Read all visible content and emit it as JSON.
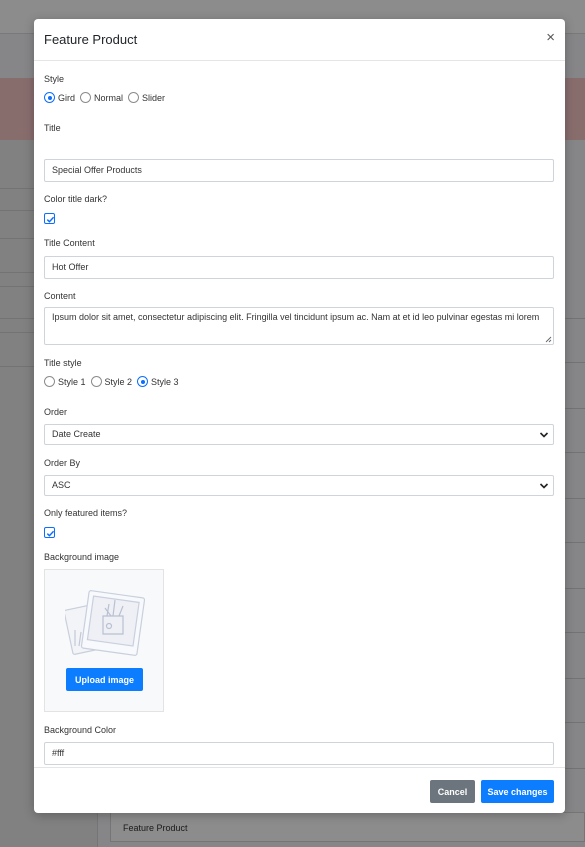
{
  "modal": {
    "title": "Feature Product",
    "close_symbol": "×"
  },
  "form": {
    "style": {
      "label": "Style",
      "options": [
        "Gird",
        "Normal",
        "Slider"
      ],
      "selected": "Gird"
    },
    "title": {
      "label": "Title",
      "value": "Special Offer Products"
    },
    "color_title_dark": {
      "label": "Color title dark?",
      "checked": true
    },
    "title_content": {
      "label": "Title Content",
      "value": "Hot Offer"
    },
    "content": {
      "label": "Content",
      "value": "Ipsum dolor sit amet, consectetur adipiscing elit. Fringilla vel tincidunt ipsum ac. Nam at et id leo pulvinar egestas mi lorem"
    },
    "title_style": {
      "label": "Title style",
      "options": [
        "Style 1",
        "Style 2",
        "Style 3"
      ],
      "selected": "Style 3"
    },
    "order": {
      "label": "Order",
      "value": "Date Create"
    },
    "order_by": {
      "label": "Order By",
      "value": "ASC"
    },
    "only_featured": {
      "label": "Only featured items?",
      "checked": true
    },
    "background_image": {
      "label": "Background image",
      "upload_label": "Upload image"
    },
    "background_color": {
      "label": "Background Color",
      "value": "#fff"
    }
  },
  "footer": {
    "cancel_label": "Cancel",
    "save_label": "Save changes"
  },
  "background": {
    "list_item_label": "Feature Product"
  },
  "colors": {
    "primary": "#0d7dff",
    "secondary": "#6c757d"
  }
}
